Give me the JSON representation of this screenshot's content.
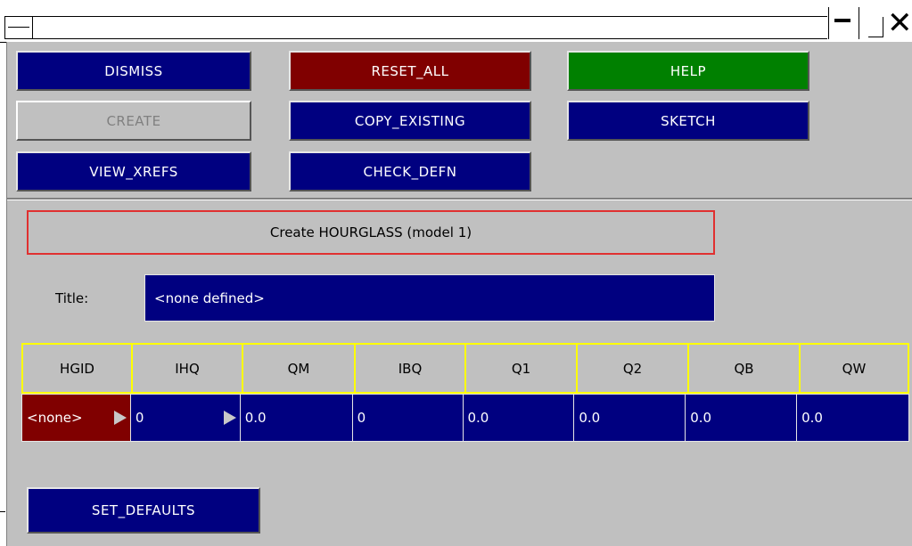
{
  "window": {
    "close_glyph": "✕"
  },
  "toolbar": {
    "dismiss": "DISMISS",
    "reset_all": "RESET_ALL",
    "help": "HELP",
    "create": "CREATE",
    "copy_existing": "COPY_EXISTING",
    "sketch": "SKETCH",
    "view_xrefs": "VIEW_XREFS",
    "check_defn": "CHECK_DEFN"
  },
  "panel": {
    "header": "Create HOURGLASS (model 1)",
    "title_label": "Title:",
    "title_value": "<none defined>"
  },
  "table": {
    "columns": [
      "HGID",
      "IHQ",
      "QM",
      "IBQ",
      "Q1",
      "Q2",
      "QB",
      "QW"
    ],
    "values": [
      "<none>",
      "0",
      "0.0",
      "0",
      "0.0",
      "0.0",
      "0.0",
      "0.0"
    ]
  },
  "footer": {
    "set_defaults": "SET_DEFAULTS"
  },
  "colors": {
    "navy": "#000080",
    "maroon": "#800000",
    "green": "#008000",
    "panel_grey": "#c0c0c0",
    "header_border": "#e03030",
    "grid_border": "#ffff00"
  }
}
